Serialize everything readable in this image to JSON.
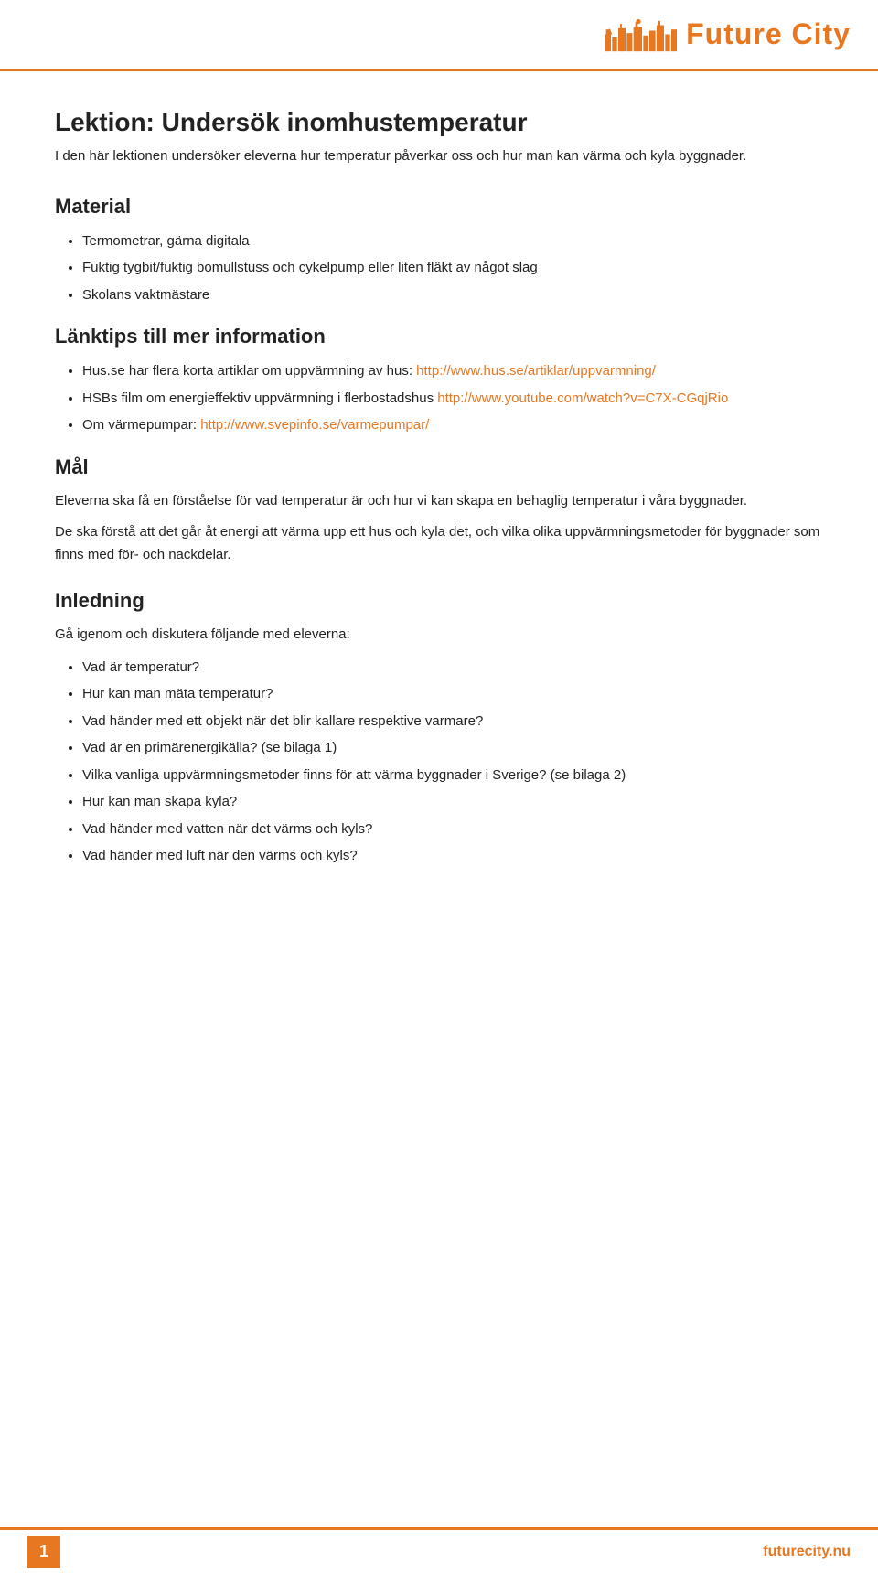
{
  "header": {
    "logo_text": "Future City",
    "site_url": "futurecity.nu"
  },
  "page": {
    "title": "Lektion: Undersök inomhustemperatur",
    "subtitle": "I den här lektionen undersöker eleverna hur temperatur påverkar oss och hur man kan värma och kyla byggnader.",
    "material_heading": "Material",
    "material_items": [
      "Termometrar, gärna digitala",
      "Fuktig tygbit/fuktig bomullstuss och cykelpump eller liten fläkt av något slag",
      "Skolans vaktmästare"
    ],
    "links_heading": "Länktips till mer information",
    "links_intro": "",
    "links_items": [
      {
        "text_before": "Hus.se har flera korta artiklar om uppvärmning av hus: ",
        "link_text": "http://www.hus.se/artiklar/uppvarmning/",
        "link_href": "http://www.hus.se/artiklar/uppvarmning/",
        "text_after": ""
      },
      {
        "text_before": "HSBs film om energieffektiv uppvärmning i flerbostadshus ",
        "link_text": "http://www.youtube.com/watch?v=C7X-CGqjRio",
        "link_href": "http://www.youtube.com/watch?v=C7X-CGqjRio",
        "text_after": ""
      },
      {
        "text_before": "Om värmepumpar: ",
        "link_text": "http://www.svepinfo.se/varmepumpar/",
        "link_href": "http://www.svepinfo.se/varmepumpar/",
        "text_after": ""
      }
    ],
    "maal_heading": "Mål",
    "maal_para1": "Eleverna ska få en förståelse för vad temperatur är och hur vi kan skapa en behaglig temperatur i våra byggnader.",
    "maal_para2": "De ska förstå att det går åt energi att värma upp ett hus och kyla det, och vilka olika uppvärmningsmetoder för byggnader som finns med för- och nackdelar.",
    "inledning_heading": "Inledning",
    "inledning_intro": "Gå igenom och diskutera följande med eleverna:",
    "inledning_items": [
      "Vad är temperatur?",
      "Hur kan man mäta temperatur?",
      "Vad händer med ett objekt när det blir kallare respektive varmare?",
      "Vad är en primärenergikälla? (se bilaga 1)",
      "Vilka vanliga uppvärmningsmetoder finns för att värma byggnader i Sverige? (se bilaga 2)",
      "Hur kan man skapa kyla?",
      "Vad händer med vatten när det värms och kyls?",
      "Vad händer med luft när den värms och kyls?"
    ],
    "footer_page": "1",
    "footer_url": "futurecity.nu"
  }
}
